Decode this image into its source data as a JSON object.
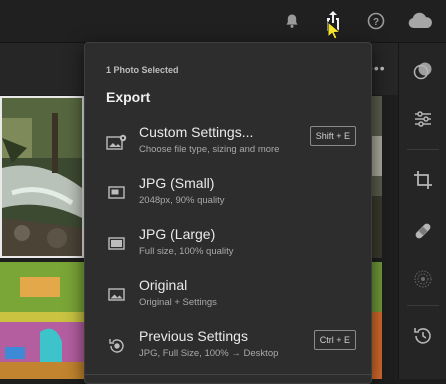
{
  "topbar": {
    "icons": [
      "bell-icon",
      "share-export-icon",
      "help-icon",
      "cloud-icon"
    ],
    "more_label": "•••"
  },
  "right_panel": {
    "icons": [
      "presets-icon",
      "edit-sliders-icon",
      "crop-icon",
      "healing-bandage-icon",
      "masking-icon",
      "history-icon"
    ]
  },
  "export_menu": {
    "subtitle": "1 Photo Selected",
    "title": "Export",
    "items": [
      {
        "label": "Custom Settings...",
        "description": "Choose file type, sizing and more",
        "shortcut": "Shift + E",
        "icon": "image-settings-icon"
      },
      {
        "label": "JPG (Small)",
        "description": "2048px, 90% quality",
        "shortcut": "",
        "icon": "image-small-icon"
      },
      {
        "label": "JPG (Large)",
        "description": "Full size, 100% quality",
        "shortcut": "",
        "icon": "image-large-icon"
      },
      {
        "label": "Original",
        "description": "Original + Settings",
        "shortcut": "",
        "icon": "image-original-icon"
      },
      {
        "label": "Previous Settings",
        "description": "JPG, Full Size, 100% → Desktop",
        "shortcut": "Ctrl + E",
        "icon": "previous-settings-icon"
      }
    ]
  },
  "colors": {
    "menu_bg": "#2d2d2d",
    "app_bg": "#1e1e1e",
    "cursor_yellow": "#f5e52a"
  }
}
